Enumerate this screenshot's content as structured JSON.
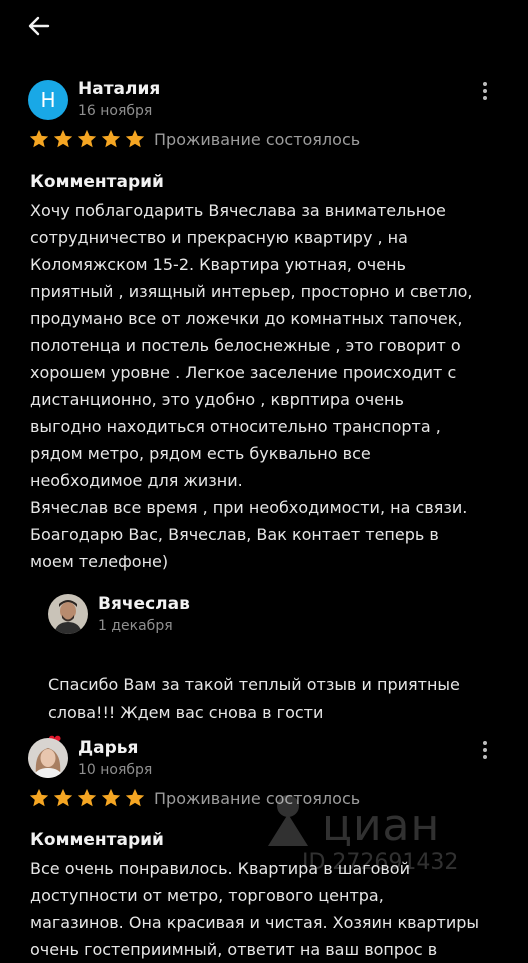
{
  "header": {
    "back_icon": "arrow-left-icon"
  },
  "reviews": [
    {
      "author": "Наталия",
      "avatar_letter": "Н",
      "date": "16 ноября",
      "stars": 5,
      "status": "Проживание состоялось",
      "heading": "Комментарий",
      "text": "Хочу поблагодарить Вячеслава за внимательное\nсотрудничество и прекрасную квартиру , на\nКоломяжском  15-2. Квартира уютная, очень\nприятный , изящный интерьер, просторно и светло,\nпродумано все от ложечки до комнатных тапочек,\nполотенца и постель белоснежные , это говорит о\nхорошем уровне . Легкое заселение происходит с\nдистанционно, это удобно , кврптира очень\nвыгодно находиться относительно транспорта ,\nрядом метро, рядом есть буквально все\nнеобходимое для жизни.\nВячеслав все время , при необходимости, на связи.\nБоагодарю Вас, Вячеслав, Вак контает теперь в\nмоем телефоне)",
      "reply": {
        "author": "Вячеслав",
        "date": "1 декабря",
        "text": "Спасибо Вам за такой теплый отзыв и приятные\nслова!!! Ждем вас снова в гости",
        "emoji": "❤"
      }
    },
    {
      "author": "Дарья",
      "date": "10 ноября",
      "stars": 5,
      "status": "Проживание состоялось",
      "heading": "Комментарий",
      "text": "Все очень понравилось. Квартира в шаговой\nдоступности от метро, торгового центра,\nмагазинов. Она красивая и чистая. Хозяин квартиры\nочень гостеприимный, ответит на ваш вопрос в"
    }
  ],
  "watermark": {
    "brand": "циан",
    "id": "ID 272691432"
  },
  "colors": {
    "background": "#000000",
    "star": "#f5a623",
    "accent_avatar": "#19a8e6",
    "heart": "#e0182d"
  }
}
